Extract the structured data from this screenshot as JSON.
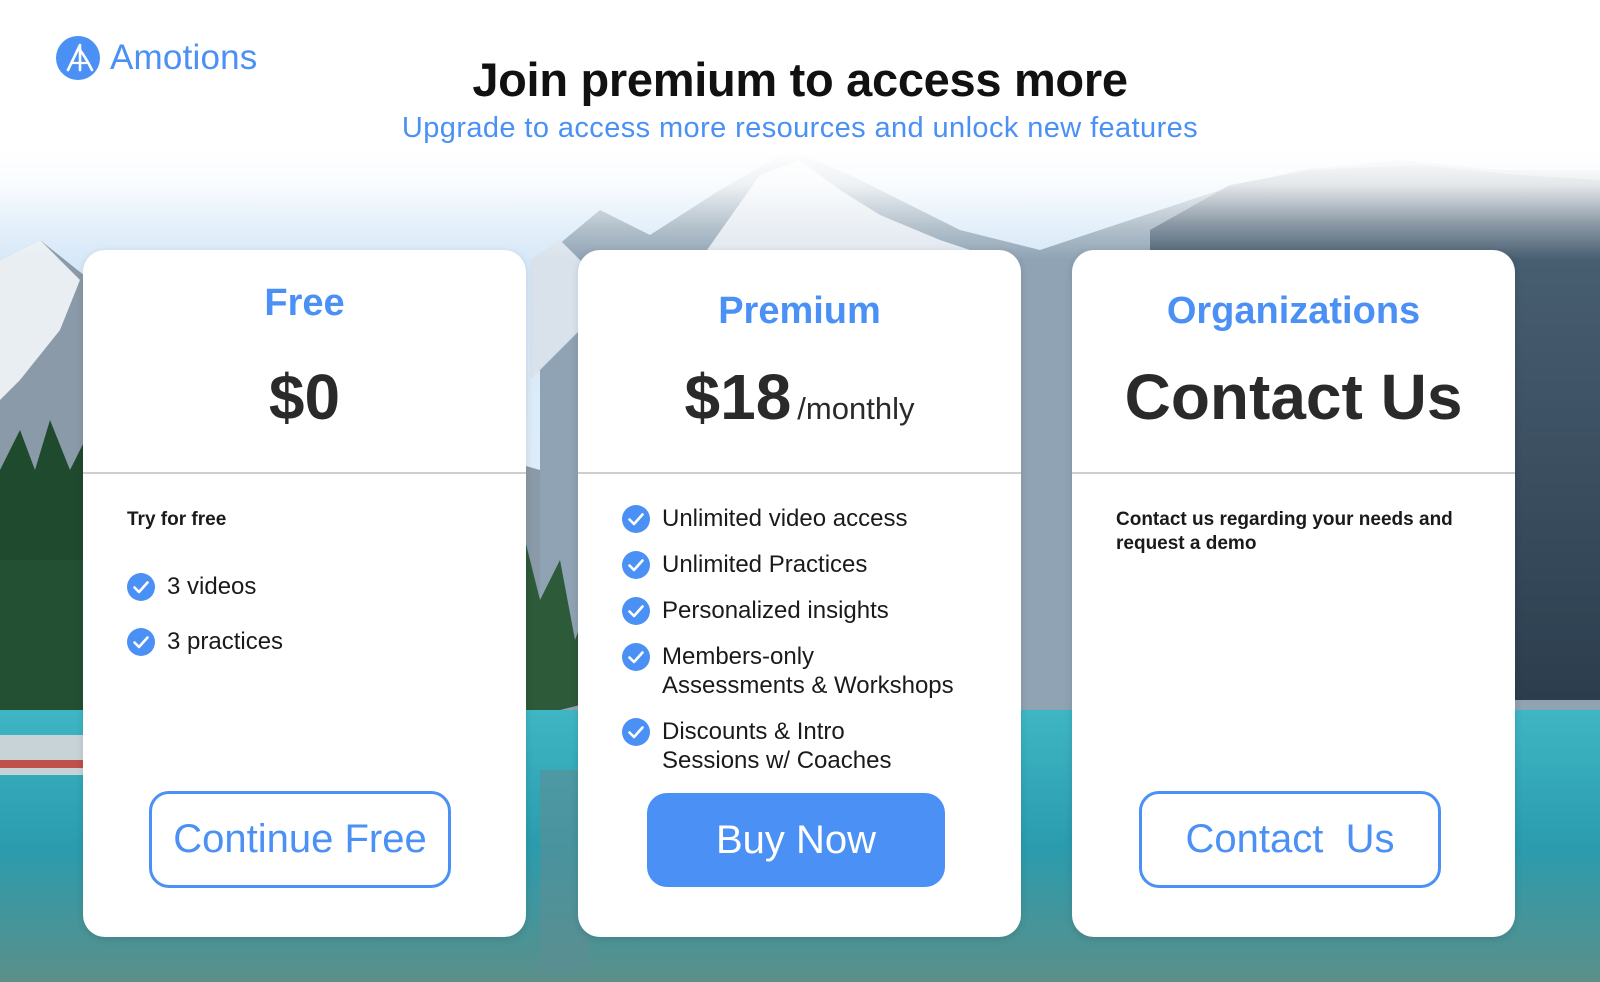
{
  "brand": {
    "name": "Amotions",
    "accent": "#4a90f5"
  },
  "header": {
    "title": "Join premium to access more",
    "subtitle": "Upgrade to access more resources and unlock new features"
  },
  "plans": [
    {
      "name": "Free",
      "price": "$0",
      "period": "",
      "intro": "Try for free",
      "features": [
        "3 videos",
        "3 practices"
      ],
      "button_label": "Continue Free"
    },
    {
      "name": "Premium",
      "price": "$18",
      "period": "/monthly",
      "intro": "",
      "features": [
        "Unlimited video access",
        "Unlimited Practices",
        "Personalized insights",
        "Members-only\nAssessments & Workshops",
        "Discounts & Intro\nSessions w/ Coaches"
      ],
      "button_label": "Buy Now"
    },
    {
      "name": "Organizations",
      "price": "Contact Us",
      "period": "",
      "intro": "Contact us regarding your needs and request a demo",
      "features": [],
      "button_label": "Contact  Us"
    }
  ],
  "icons": {
    "feature_check": "check-circle-icon",
    "logo": "logo-icon",
    "background": "mountain-lake-scenery"
  },
  "colors": {
    "card_bg": "#ffffff",
    "title_text": "#111111",
    "price_text": "#2a2a2a",
    "divider": "#cfcfcf"
  }
}
